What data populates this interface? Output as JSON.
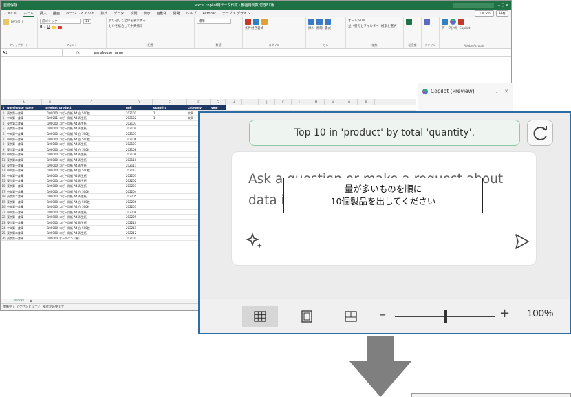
{
  "excel": {
    "title": "excel copilot用データ作成・動画用関数 付きEX版",
    "autosave": "自動保存",
    "menu": [
      "ファイル",
      "ホーム",
      "挿入",
      "描画",
      "ページ レイアウト",
      "数式",
      "データ",
      "校閲",
      "表示",
      "自動化",
      "開発",
      "ヘルプ",
      "Acrobat",
      "テーブル デザイン"
    ],
    "active_menu": "ホーム",
    "menu_right": [
      "コメント",
      "共有"
    ],
    "ribbon_groups": [
      "クリップボード",
      "フォント",
      "配置",
      "数値",
      "スタイル",
      "セル",
      "編集",
      "秘密度",
      "アドイン",
      "Adobe Acrobat"
    ],
    "ribbon_items": {
      "paste": "貼り付け",
      "font": "游ゴシック",
      "size": "11",
      "wrap": "折り返して全体を表示する",
      "merge": "セルを結合して中央揃え",
      "format": "標準",
      "cond": "条件付き書式",
      "table": "テーブルとして書式設定",
      "cellstyle": "セルのスタイル",
      "insert": "挿入",
      "delete": "削除",
      "formatcell": "書式",
      "autosum": "オート SUM",
      "sort": "並べ替えとフィルター",
      "find": "検索と選択",
      "sensitivity": "秘密度",
      "addin": "アドイン",
      "analyze": "データ分析",
      "copilot": "Copilot",
      "pdf": "PDF を作成してリンクを共有"
    },
    "namebox": "A1",
    "fx": "fx",
    "formula": "warehouse name",
    "columns": [
      "A",
      "B",
      "C",
      "D",
      "E",
      "F",
      "G",
      "H",
      "I",
      "J",
      "K",
      "L",
      "M",
      "N",
      "O",
      "P"
    ],
    "headers": [
      "warehouse name",
      "product",
      "product",
      "null",
      "quantity",
      "category",
      "year"
    ],
    "rows": [
      [
        "東京第一倉庫",
        "100000",
        "コピー用紙 A4 白 500枚",
        "202101",
        "1",
        "文具",
        "2021"
      ],
      [
        "中央第一倉庫",
        "100001",
        "コピー用紙 A4 再生紙",
        "202102",
        "1",
        "文具",
        "2021"
      ],
      [
        "東京第二倉庫",
        "100000",
        "コピー用紙 A4 再生紙",
        "202103",
        "",
        "",
        ""
      ],
      [
        "東京第一倉庫",
        "100000",
        "コピー用紙 A4 再生紙",
        "202104",
        "",
        "",
        ""
      ],
      [
        "中央第一倉庫",
        "100000",
        "コピー用紙 A4 白 500枚",
        "202105",
        "",
        "",
        ""
      ],
      [
        "中央第一倉庫",
        "100000",
        "コピー用紙 A4 白 500枚",
        "202106",
        "",
        "",
        ""
      ],
      [
        "東京第一倉庫",
        "100000",
        "コピー用紙 A4 再生紙",
        "202107",
        "",
        "",
        ""
      ],
      [
        "東京第一倉庫",
        "100000",
        "コピー用紙 A4 白 500枚",
        "202108",
        "",
        "",
        ""
      ],
      [
        "中央第一倉庫",
        "100000",
        "コピー用紙 A4 再生紙",
        "202109",
        "",
        "",
        ""
      ],
      [
        "東京第二倉庫",
        "100000",
        "コピー用紙 A4 再生紙",
        "202110",
        "",
        "",
        ""
      ],
      [
        "東京第一倉庫",
        "100000",
        "コピー用紙 A4 再生紙",
        "202111",
        "",
        "",
        ""
      ],
      [
        "中央第一倉庫",
        "100000",
        "コピー用紙 A4 白 500枚",
        "202112",
        "",
        "",
        ""
      ],
      [
        "中央第一倉庫",
        "100000",
        "コピー用紙 A4 再生紙",
        "202201",
        "",
        "",
        ""
      ],
      [
        "東京第一倉庫",
        "100000",
        "コピー用紙 A4 再生紙",
        "202202",
        "",
        "",
        ""
      ],
      [
        "東京第一倉庫",
        "100000",
        "コピー用紙 A4 再生紙",
        "202203",
        "",
        "",
        ""
      ],
      [
        "中央第一倉庫",
        "100000",
        "コピー用紙 A4 白 500枚",
        "202204",
        "",
        "",
        ""
      ],
      [
        "東京第二倉庫",
        "100000",
        "コピー用紙 A4 再生紙",
        "202205",
        "",
        "",
        ""
      ],
      [
        "東京第一倉庫",
        "100000",
        "コピー用紙 A4 白 500枚",
        "202206",
        "",
        "",
        ""
      ],
      [
        "中央第一倉庫",
        "100000",
        "コピー用紙 A4 白 500枚",
        "202207",
        "",
        "",
        ""
      ],
      [
        "中央第一倉庫",
        "100000",
        "コピー用紙 A4 再生紙",
        "202208",
        "",
        "",
        ""
      ],
      [
        "東京第一倉庫",
        "100000",
        "コピー用紙 A4 再生紙",
        "202209",
        "",
        "",
        ""
      ],
      [
        "東京第一倉庫",
        "100000",
        "コピー用紙 A4 再生紙",
        "202210",
        "",
        "",
        ""
      ],
      [
        "中央第一倉庫",
        "100000",
        "コピー用紙 A4 白 500枚",
        "202211",
        "",
        "",
        ""
      ],
      [
        "東京第二倉庫",
        "100000",
        "コピー用紙 A4 再生紙",
        "202212",
        "",
        "",
        ""
      ],
      [
        "東京第一倉庫",
        "100000",
        "ボールペン（黒）",
        "202101",
        "",
        "",
        ""
      ]
    ],
    "sheet_tab": "stocks",
    "status": "準備完了  アクセシビリティ: 検討が必要です"
  },
  "copilot": {
    "title": "Copilot (Preview)",
    "suggestion": "Top 10 in 'product' by total 'quantity'.",
    "ask_placeholder": "Ask a question or make a request about data in a table",
    "note_line1": "量が多いものを順に",
    "note_line2": "10個製品を出してください"
  },
  "zoom": {
    "minus": "–",
    "plus": "+",
    "percent": "100%",
    "level": 0.5
  },
  "colors": {
    "excel_green": "#1e7145",
    "table_header": "#1f3864",
    "zoom_border": "#2e6da4",
    "arrow": "#7f7f7f",
    "suggest_border": "#8ccaa6"
  },
  "icons": [
    "grid-view-icon",
    "page-layout-icon",
    "page-break-icon",
    "refresh-icon",
    "sparkle-icon",
    "send-icon",
    "copilot-logo-icon",
    "down-arrow-icon"
  ]
}
